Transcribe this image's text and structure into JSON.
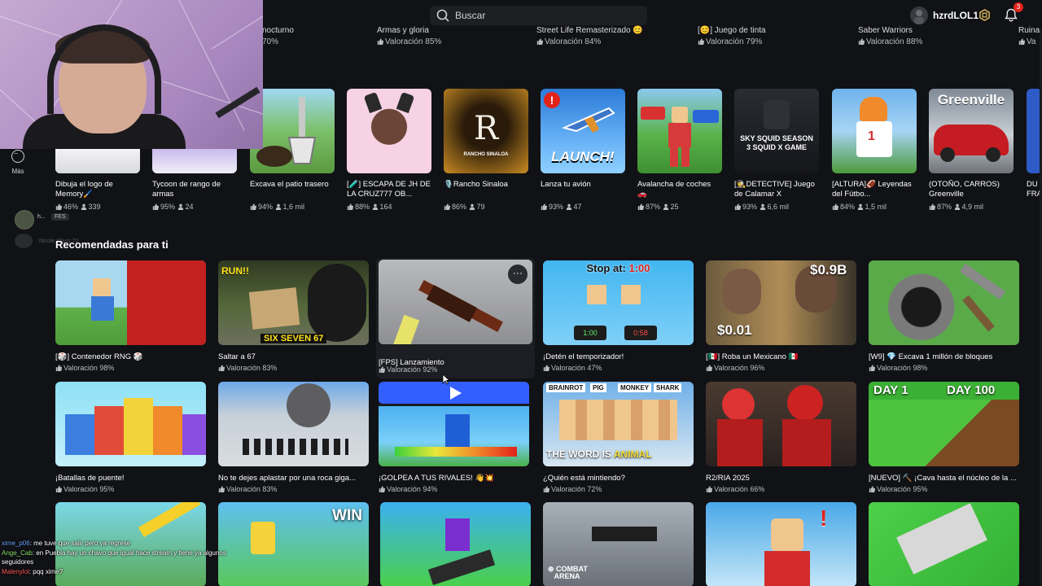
{
  "topbar": {
    "search_placeholder": "Buscar",
    "username": "hzrdLOL1",
    "notification_count": "3"
  },
  "prev_row": [
    {
      "title": "nocturno",
      "rating": "70%"
    },
    {
      "title": "Armas y gloria",
      "rating": "Valoración 85%"
    },
    {
      "title": "Street Life Remasterizado 😊",
      "rating": "Valoración 84%"
    },
    {
      "title": "[😊] Juego de tinta",
      "rating": "Valoración 79%"
    },
    {
      "title": "Saber Warriors",
      "rating": "Valoración 88%"
    },
    {
      "title": "Ruina",
      "rating": "Va"
    }
  ],
  "sidebar": {
    "more_label": "Más",
    "friend_name_1": "h...",
    "friend_chip": "FES",
    "friend_name_2": "Nicole Plays 70"
  },
  "row1": [
    {
      "name": "Dibuja el logo de Memory🖌️",
      "rating": "46%",
      "players": "339",
      "label": ""
    },
    {
      "name": "Tycoon de rango de armas",
      "rating": "95%",
      "players": "24",
      "label": ""
    },
    {
      "name": "Excava el patio trasero",
      "rating": "94%",
      "players": "1,6 mil",
      "label": ""
    },
    {
      "name": "[🧪] ESCAPA DE JH DE LA CRUZ777 OB...",
      "rating": "88%",
      "players": "164",
      "label": ""
    },
    {
      "name": "🎙️Rancho Sinaloa",
      "rating": "86%",
      "players": "79",
      "label": "RANCHO SINALOA"
    },
    {
      "name": "Lanza tu avión",
      "rating": "93%",
      "players": "47",
      "label": "LAUNCH!"
    },
    {
      "name": "Avalancha de coches 🚗",
      "rating": "87%",
      "players": "25",
      "label": ""
    },
    {
      "name": "[🕵️DETECTIVE] Juego de Calamar X",
      "rating": "93%",
      "players": "6,6 mil",
      "label": "SKY SQUID SEASON 3 SQUID X GAME"
    },
    {
      "name": "[ALTURA]🏈 Leyendas del Fútbo...",
      "rating": "84%",
      "players": "1,5 mil",
      "label": ""
    },
    {
      "name": "(OTOÑO, CARROS) Greenville",
      "rating": "87%",
      "players": "4,9 mil",
      "label": "Greenville"
    },
    {
      "name": "DU FRA",
      "rating": "",
      "players": "",
      "label": ""
    }
  ],
  "section_title": "Recomendadas para ti",
  "recommended": [
    {
      "name": "[🎲] Contenedor RNG 🎲",
      "rating": "Valoración 98%",
      "label": ""
    },
    {
      "name": "Saltar a 67",
      "rating": "Valoración 83%",
      "label": "RUN!! SIX SEVEN 67"
    },
    {
      "name": "[FPS] Lanzamiento",
      "rating": "Valoración 92%",
      "label": ""
    },
    {
      "name": "¡Detén el temporizador!",
      "rating": "Valoración 47%",
      "label": "Stop at: 1:00"
    },
    {
      "name": "[🇲🇽] Roba un Mexicano 🇲🇽",
      "rating": "Valoración 96%",
      "label": "$0.01"
    },
    {
      "name": "[W9] 💎 Excava 1 millón de bloques",
      "rating": "Valoración 98%",
      "label": ""
    },
    {
      "name": "¡Batallas de puente!",
      "rating": "Valoración 95%",
      "label": ""
    },
    {
      "name": "No te dejes aplastar por una roca giga...",
      "rating": "Valoración 83%",
      "label": ""
    },
    {
      "name": "¡GOLPEA A TUS RIVALES! 👋💥",
      "rating": "Valoración 94%",
      "label": ""
    },
    {
      "name": "¿Quién está mintiendo?",
      "rating": "Valoración 72%",
      "label": "THE WORD IS ANIMAL"
    },
    {
      "name": "R2/RIA 2025",
      "rating": "Valoración 66%",
      "label": ""
    },
    {
      "name": "[NUEVO] ⛏️ ¡Cava hasta el núcleo de la ...",
      "rating": "Valoración 95%",
      "label": "DAY 1 DAY 100"
    },
    {
      "name": "",
      "rating": "",
      "label": ""
    },
    {
      "name": "",
      "rating": "",
      "label": "WIN"
    },
    {
      "name": "",
      "rating": "",
      "label": ""
    },
    {
      "name": "",
      "rating": "",
      "label": "COMBAT ARENA"
    },
    {
      "name": "",
      "rating": "",
      "label": ""
    },
    {
      "name": "",
      "rating": "",
      "label": ""
    }
  ],
  "chat": [
    {
      "user": "xime_p06",
      "msg": ": me tuve que salir pero ya regrese"
    },
    {
      "user": "Ange_Cab",
      "msg": ": en Puebla hay un chavo que igual hace stream y tiene ya algunos seguidores"
    },
    {
      "user": "Malenylol",
      "msg": ": pqq xime?"
    }
  ]
}
